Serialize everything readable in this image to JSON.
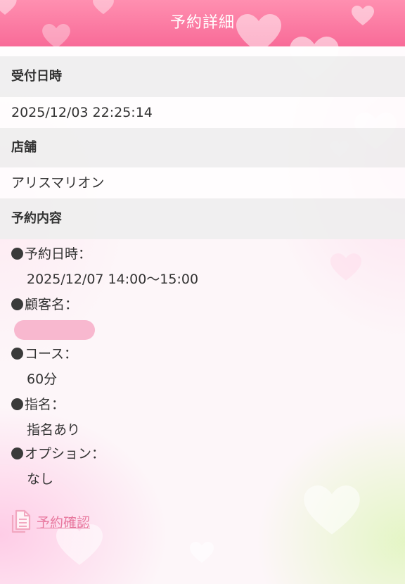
{
  "header": {
    "title": "予約詳細"
  },
  "reception": {
    "label": "受付日時",
    "value": "2025/12/03 22:25:14"
  },
  "store": {
    "label": "店舗",
    "value": "アリスマリオン"
  },
  "reservation": {
    "label": "予約内容",
    "items": [
      {
        "label": "予約日時：",
        "value": "2025/12/07 14:00〜15:00"
      },
      {
        "label": "顧客名：",
        "value": ""
      },
      {
        "label": "コース：",
        "value": "60分"
      },
      {
        "label": "指名：",
        "value": "指名あり"
      },
      {
        "label": "オプション：",
        "value": "なし"
      }
    ]
  },
  "confirm_link": {
    "label": "予約確認",
    "icon": "document-icon"
  },
  "colors": {
    "header_pink": "#f86b98",
    "link_pink": "#e8789e",
    "redaction_pink": "#f8b8cf"
  }
}
